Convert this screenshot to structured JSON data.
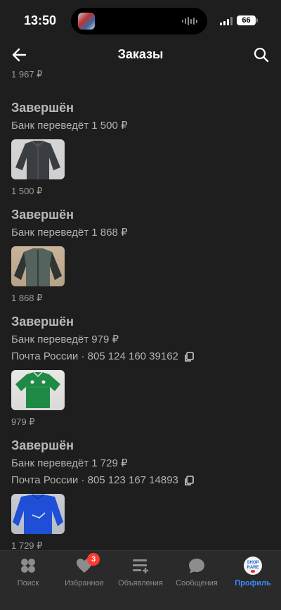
{
  "status_bar": {
    "time": "13:50",
    "battery": "66"
  },
  "header": {
    "title": "Заказы",
    "back_icon": "arrow-left-icon",
    "search_icon": "search-icon"
  },
  "partial_top_price": "1 967 ₽",
  "orders": [
    {
      "status": "Завершён",
      "bank_line": "Банк переведёт 1 500 ₽",
      "shipping_line": "",
      "price": "1 500 ₽",
      "item": "dark-jacket"
    },
    {
      "status": "Завершён",
      "bank_line": "Банк переведёт 1 868 ₽",
      "shipping_line": "",
      "price": "1 868 ₽",
      "item": "grey-green-jacket"
    },
    {
      "status": "Завершён",
      "bank_line": "Банк переведёт 979 ₽",
      "shipping_line": "Почта России · 805 124 160 39162",
      "price": "979 ₽",
      "item": "green-football-shirt"
    },
    {
      "status": "Завершён",
      "bank_line": "Банк переведёт 1 729 ₽",
      "shipping_line": "Почта России · 805 123 167 14893",
      "price": "1 729 ₽",
      "item": "blue-top"
    }
  ],
  "tabbar": {
    "tabs": [
      {
        "label": "Поиск",
        "icon": "search-circles-icon",
        "active": false
      },
      {
        "label": "Избранное",
        "icon": "heart-icon",
        "active": false,
        "badge": "3"
      },
      {
        "label": "Объявления",
        "icon": "listings-icon",
        "active": false
      },
      {
        "label": "Сообщения",
        "icon": "chat-bubble-icon",
        "active": false
      },
      {
        "label": "Профиль",
        "icon": "profile-avatar",
        "active": true,
        "avatar_logo": "SHOP RARE"
      }
    ]
  },
  "colors": {
    "background": "#1e1e1e",
    "tabbar": "#2a2a2a",
    "accent": "#3d8bfd",
    "badge": "#ff3b30"
  }
}
